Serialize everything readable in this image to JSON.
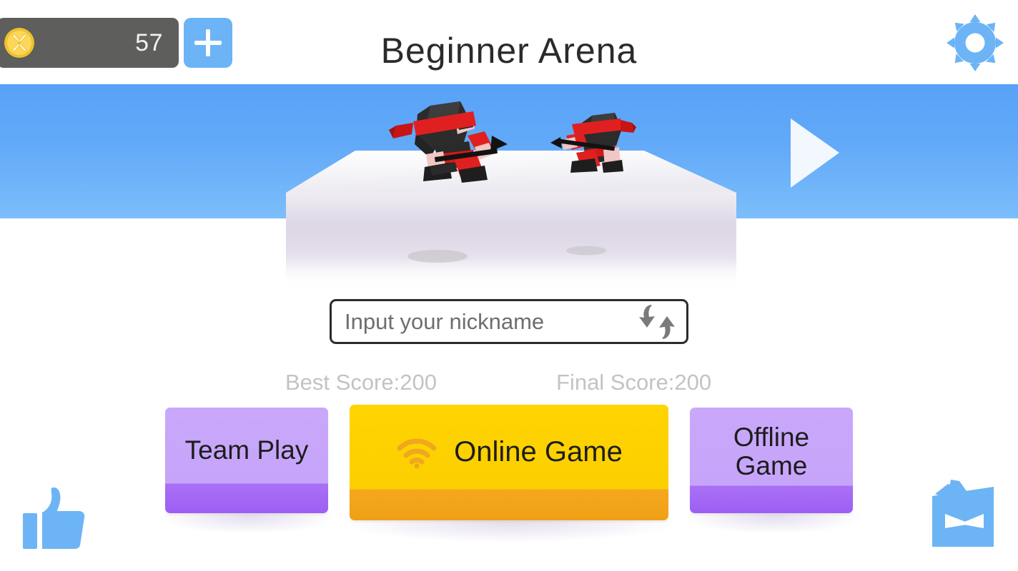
{
  "header": {
    "coin_icon": "shuriken-coin-icon",
    "coin_amount": "57",
    "add_coins_label": "+",
    "title": "Beginner Arena",
    "settings_icon": "gear-icon"
  },
  "scene": {
    "next_arena_icon": "play-arrow-icon",
    "characters": [
      {
        "name": "ninja-left",
        "headband_color": "#e02020",
        "body_color": "#2a2a2a",
        "weapon": "spear"
      },
      {
        "name": "ninja-right",
        "headband_color": "#e02020",
        "body_color": "#2a2a2a",
        "weapon": "spear"
      }
    ],
    "sky_color_top": "#58a2f7",
    "sky_color_bottom": "#7cbefb",
    "platform_color": "#f4f2f6"
  },
  "nickname": {
    "value": "",
    "placeholder": "Input your nickname",
    "randomize_icon": "shuffle-arrows-icon"
  },
  "scores": {
    "best_label": "Best Score:200",
    "final_label": "Final Score:200",
    "text_color": "#c3c3c3"
  },
  "buttons": {
    "team_play": {
      "label": "Team Play",
      "color": "#c6a4fa",
      "edge_color": "#9d5ff3"
    },
    "online_game": {
      "label": "Online Game",
      "color": "#ffd400",
      "edge_color": "#efa017",
      "icon": "wifi-icon"
    },
    "offline_game": {
      "label": "Offline\nGame",
      "line1": "Offline",
      "line2": "Game",
      "color": "#c6a4fa",
      "edge_color": "#9d5ff3"
    }
  },
  "footer": {
    "like_icon": "thumbs-up-icon",
    "mascot_icon": "ninja-mascot-face-icon",
    "icon_color": "#6cb4f5"
  }
}
